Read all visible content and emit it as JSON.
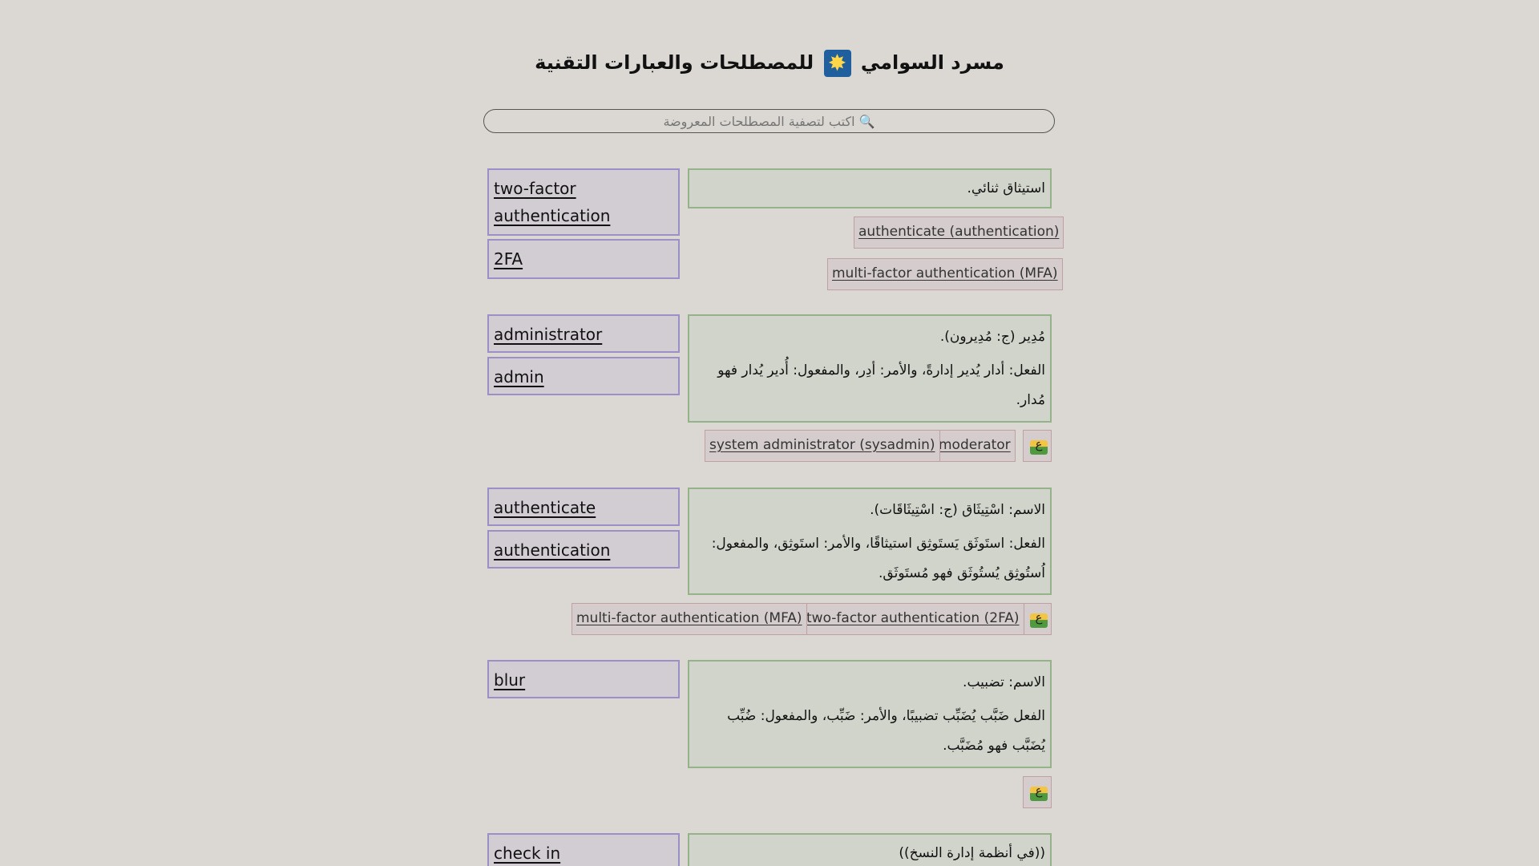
{
  "header": {
    "title_before": "مسرد السوامي",
    "title_after": "للمصطلحات والعبارات التقنية",
    "emoji_icon": "sparkle-icon"
  },
  "search": {
    "placeholder": "🔍 اكتب لتصفية المصطلحات المعروضة"
  },
  "entries": [
    {
      "terms": [
        "two-factor authentication",
        "2FA"
      ],
      "definition": "استيثاق ثنائي.",
      "related": [
        "authenticate (authentication)",
        "multi-factor authentication (MFA)"
      ]
    },
    {
      "terms": [
        "administrator",
        "admin"
      ],
      "definition": "مُدِير (ج: مُدِيرون).",
      "verb": "الفعل: أدار يُدير إدارةً، والأمر: أدِر، والمفعول: أُدير يُدار فهو مُدار.",
      "related": [
        "moderator",
        "system administrator (sysadmin)"
      ],
      "image_glyph": "ع"
    },
    {
      "terms": [
        "authenticate",
        "authentication"
      ],
      "definition": "الاسم: اسْتِيثَاق (ج: اسْتِيثَاقَات).",
      "verb": "الفعل: استَوثَق يَستَوثِق استيثاقًا، والأمر: استَوثِق، والمفعول: اُستُوثِق يُستُوثَق فهو مُستَوثَق.",
      "related": [
        "two-factor authentication (2FA)",
        "multi-factor authentication (MFA)"
      ],
      "image_glyph": "ع"
    },
    {
      "terms": [
        "blur"
      ],
      "definition": "الاسم: تضبيب.",
      "verb": "الفعل ضَبَّب يُضَبِّب تضبيبًا، والأمر: ضَبِّب، والمفعول: ضُبِّب يُضَبَّب فهو مُضَبَّب.",
      "related": [],
      "image_glyph": "ع"
    },
    {
      "terms": [
        "check in"
      ],
      "definition": "((في أنظمة إدارة النسخ))",
      "related": []
    }
  ]
}
